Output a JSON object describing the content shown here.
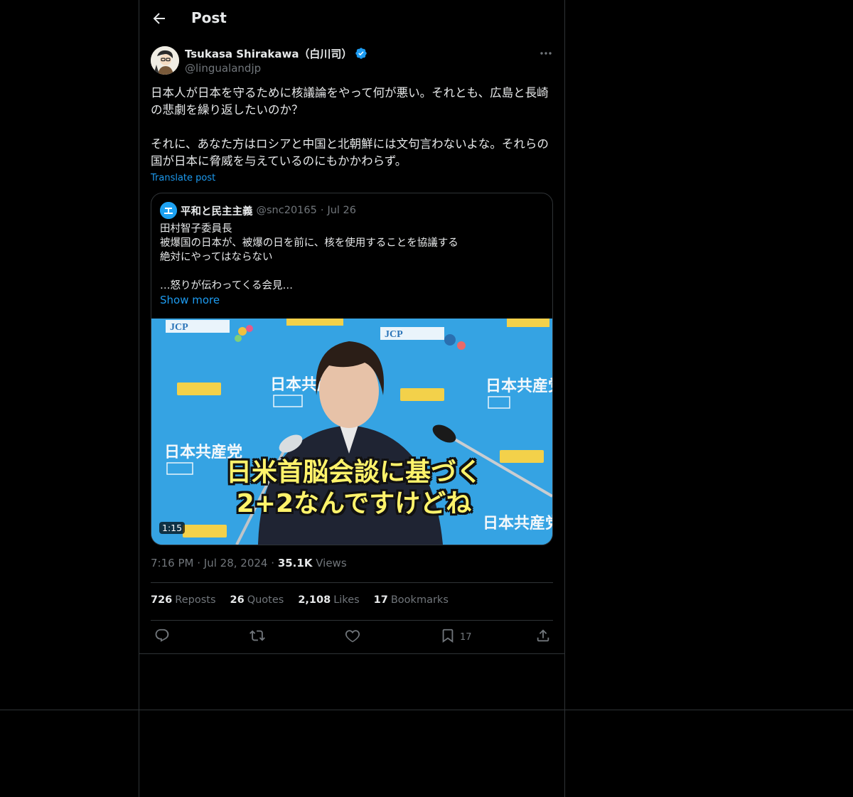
{
  "header": {
    "title": "Post",
    "back_icon": "arrow-left-icon"
  },
  "author": {
    "name": "Tsukasa Shirakawa（白川司）",
    "handle": "@lingualandjp",
    "verified": true,
    "verified_color": "#1d9bf0"
  },
  "post": {
    "text": "日本人が日本を守るために核議論をやって何が悪い。それとも、広島と長崎の悲劇を繰り返したいのか？\n\nそれに、あなた方はロシアと中国と北朝鮮には文句言わないよな。それらの国が日本に脅威を与えているのにもかかわらず。",
    "translate_label": "Translate post"
  },
  "quote": {
    "name": "平和と民主主義",
    "handle": "@snc20165",
    "separator": "·",
    "date": "Jul 26",
    "text": "田村智子委員長\n被爆国の日本が、被爆の日を前に、核を使用することを協議する\n絶対にやってはならない\n\n…怒りが伝わってくる会見…",
    "show_more": "Show more",
    "video": {
      "duration": "1:15",
      "caption": "日米首脳会談に基づく\n2+2なんですけどね",
      "banner_text": "日本共産党",
      "logo_text": "JCP"
    }
  },
  "meta": {
    "time": "7:16 PM",
    "sep1": "·",
    "date": "Jul 28, 2024",
    "sep2": "·",
    "views_count": "35.1K",
    "views_label": "Views"
  },
  "stats": {
    "reposts_count": "726",
    "reposts_label": "Reposts",
    "quotes_count": "26",
    "quotes_label": "Quotes",
    "likes_count": "2,108",
    "likes_label": "Likes",
    "bookmarks_count": "17",
    "bookmarks_label": "Bookmarks"
  },
  "actions": {
    "reply_icon": "reply-icon",
    "repost_icon": "repost-icon",
    "like_icon": "heart-icon",
    "bookmark_icon": "bookmark-icon",
    "bookmark_count": "17",
    "share_icon": "share-icon"
  },
  "colors": {
    "background": "#000000",
    "text": "#e7e9ea",
    "muted": "#71767b",
    "accent": "#1d9bf0",
    "border": "#2f3336"
  }
}
